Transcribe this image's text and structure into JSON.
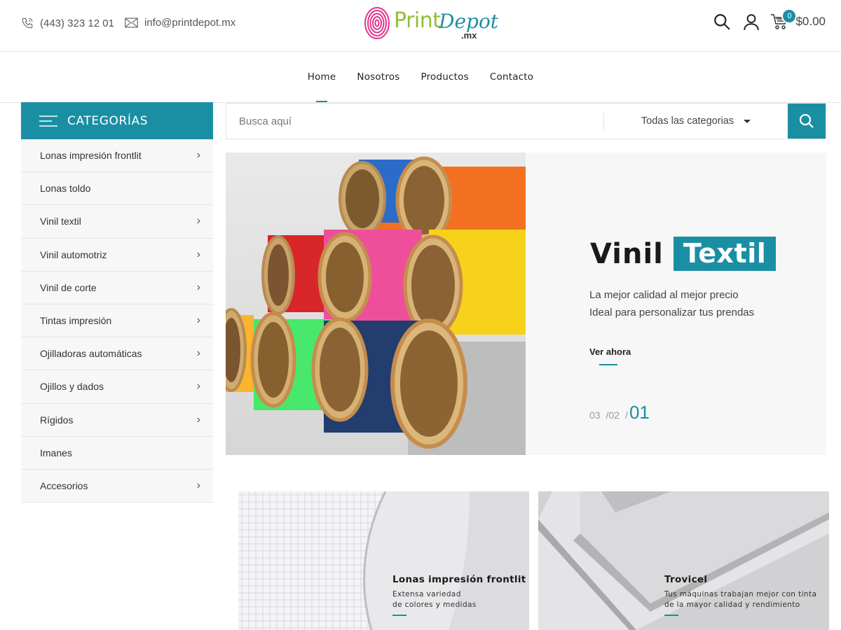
{
  "header": {
    "phone": "(443) 323 12 01",
    "email": "info@printdepot.mx",
    "logo": {
      "part1": "Print",
      "part2": "Depot",
      "part3": ".mx"
    },
    "cart_count": "0",
    "cart_total": "$0.00"
  },
  "nav": {
    "items": [
      "Home",
      "Nosotros",
      "Productos",
      "Contacto"
    ],
    "active": "Home"
  },
  "sidebar": {
    "title": "CATEGORÍAS",
    "items": [
      {
        "label": "Lonas impresión frontlit",
        "has_children": true
      },
      {
        "label": "Lonas toldo",
        "has_children": false
      },
      {
        "label": "Vinil textil",
        "has_children": true
      },
      {
        "label": "Vinil automotriz",
        "has_children": true
      },
      {
        "label": "Vinil de corte",
        "has_children": true
      },
      {
        "label": "Tintas impresión",
        "has_children": true
      },
      {
        "label": "Ojilladoras automáticas",
        "has_children": true
      },
      {
        "label": "Ojillos y dados",
        "has_children": true
      },
      {
        "label": "Rígidos",
        "has_children": true
      },
      {
        "label": "Imanes",
        "has_children": false
      },
      {
        "label": "Accesorios",
        "has_children": true
      }
    ]
  },
  "search": {
    "placeholder": "Busca aquí",
    "category": "Todas las categorias"
  },
  "hero": {
    "title_plain": "Vinil",
    "title_highlight": "Textil",
    "line1": "La mejor calidad al mejor precio",
    "line2": "Ideal para personalizar tus prendas",
    "cta": "Ver ahora",
    "pager": [
      "03",
      "/02",
      "/",
      "01"
    ]
  },
  "banners": [
    {
      "title": "Lonas impresión frontlit",
      "line1": "Extensa variedad",
      "line2": "de colores y medidas"
    },
    {
      "title": "Trovicel",
      "line1": "Tus máquinas trabajan mejor con tinta",
      "line2": "de la mayor calidad y rendimiento"
    }
  ],
  "colors": {
    "accent": "#1a8fa3",
    "logo_green": "#8fbf3a",
    "fingerprint": "#e0348a"
  }
}
